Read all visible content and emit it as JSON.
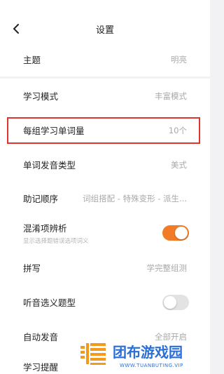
{
  "header": {
    "title": "设置",
    "back_icon": "chevron-left-icon"
  },
  "theme": {
    "label": "主题",
    "value": "明亮"
  },
  "study_mode": {
    "label": "学习模式",
    "value": "丰富模式"
  },
  "words_per_group": {
    "label": "每组学习单词量",
    "value": "10个"
  },
  "pronunciation": {
    "label": "单词发音类型",
    "value": "美式"
  },
  "mnemonic_order": {
    "label": "助记顺序",
    "value": "词组搭配 - 特殊变形 - 派生..."
  },
  "confusion": {
    "label": "混淆项辨析",
    "sub": "显示选择题错误选项词义",
    "enabled": true
  },
  "spelling": {
    "label": "拼写",
    "value": "学完整组测"
  },
  "listening": {
    "label": "听音选义题型",
    "enabled": false
  },
  "auto_pronounce": {
    "label": "自动发音",
    "value": "全部开启"
  },
  "reminder": {
    "label": "学习提醒"
  },
  "colors": {
    "accent": "#f27b27",
    "highlight": "#e0352b",
    "toggle_off": "#e3e3e3"
  }
}
